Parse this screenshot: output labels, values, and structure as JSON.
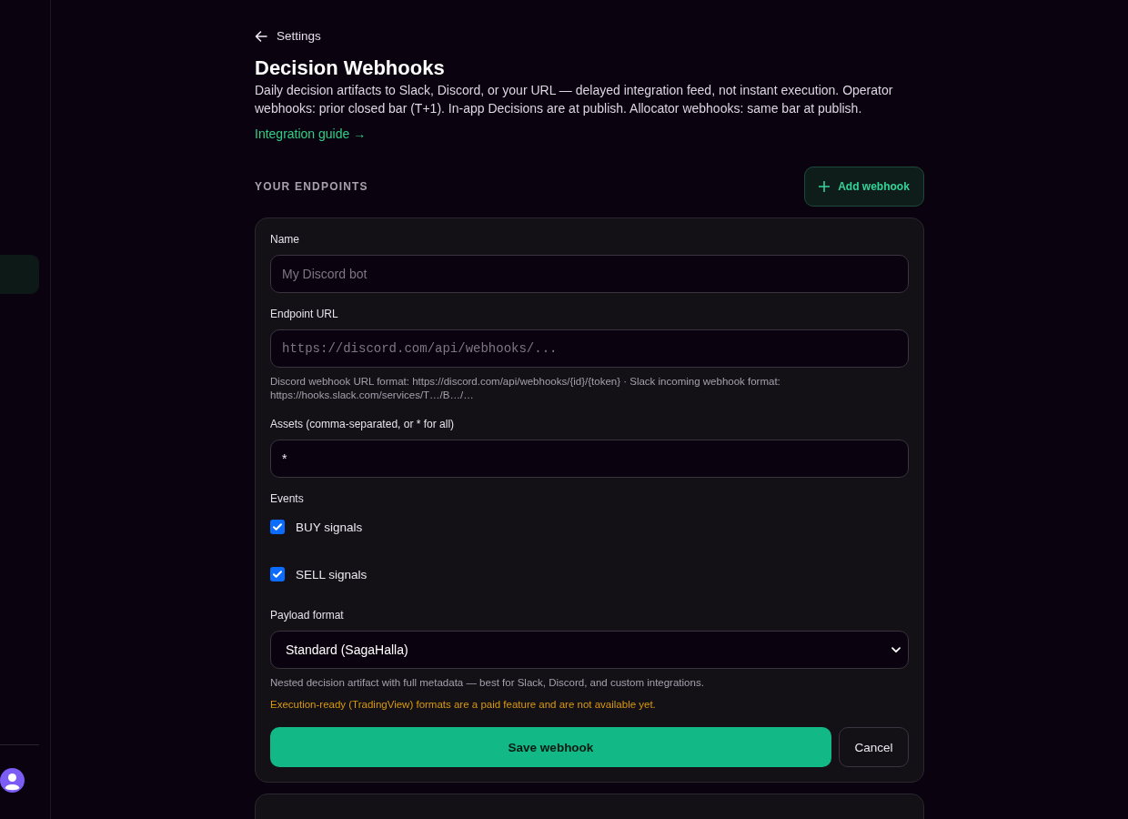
{
  "sidebar": {
    "items": [
      {
        "selected": true
      }
    ]
  },
  "back_link": {
    "label": "Settings"
  },
  "header": {
    "title": "Decision Webhooks",
    "description": "Daily decision artifacts to Slack, Discord, or your URL — delayed integration feed, not instant execution. Operator webhooks: prior closed bar (T+1). In-app Decisions are at publish. Allocator webhooks: same bar at publish.",
    "link": "Integration guide →"
  },
  "section": {
    "title": "YOUR ENDPOINTS",
    "add_button": "Add webhook"
  },
  "form": {
    "fields": [
      {
        "kind": "text",
        "label": "Name",
        "placeholder": "My Discord bot"
      },
      {
        "kind": "url",
        "label": "Endpoint URL",
        "placeholder": "https://discord.com/api/webhooks/...",
        "help": "Discord webhook URL format: https://discord.com/api/webhooks/{id}/{token} · Slack incoming webhook format: https://hooks.slack.com/services/T…/B…/…"
      },
      {
        "kind": "text",
        "label": "Assets (comma-separated, or * for all)",
        "value": "*"
      }
    ],
    "events": {
      "label": "Events",
      "options": [
        {
          "label": "BUY signals",
          "checked": true
        },
        {
          "label": "SELL signals",
          "checked": true
        }
      ]
    },
    "payload": {
      "label": "Payload format",
      "value": "Standard (SagaHalla)",
      "hint": "Nested decision artifact with full metadata — best for Slack, Discord, and custom integrations.",
      "warning": "Execution-ready (TradingView) formats are a paid feature and are not available yet."
    },
    "buttons": {
      "save": "Save webhook",
      "cancel": "Cancel"
    }
  }
}
